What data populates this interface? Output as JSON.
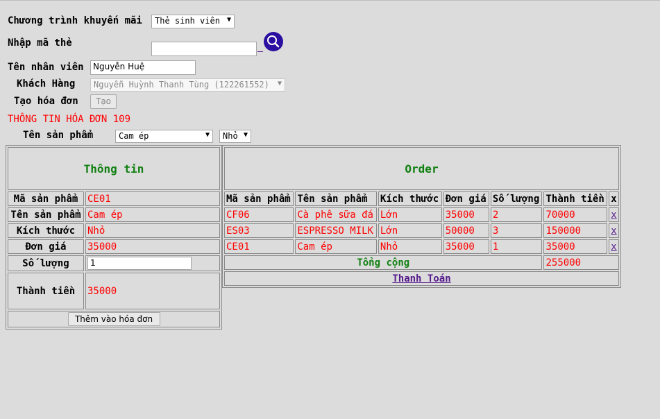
{
  "promo": {
    "label": "Chương trình khuyến mãi",
    "value": "Thẻ sinh viên"
  },
  "card": {
    "label": "Nhập mã thẻ",
    "value": ""
  },
  "employee": {
    "label": "Tên nhân viên",
    "value": "Nguyễn Huệ"
  },
  "customer": {
    "label": "Khách Hàng",
    "value": "Nguyễn Huỳnh Thanh Tùng (122261552)"
  },
  "create_invoice": {
    "label": "Tạo hóa đơn",
    "button": "Tạo"
  },
  "invoice_title": "THÔNG TIN HÓA ĐƠN 109",
  "product": {
    "label": "Tên sản phẩm",
    "value": "Cam ép",
    "size": "Nhỏ"
  },
  "info": {
    "title": "Thông tin",
    "rows": {
      "code": {
        "k": "Mã sản phẩm",
        "v": "CE01"
      },
      "name": {
        "k": "Tên sản phẩm",
        "v": "Cam ép"
      },
      "size": {
        "k": "Kích thước",
        "v": "Nhỏ"
      },
      "price": {
        "k": "Đơn giá",
        "v": "35000"
      },
      "qty": {
        "k": "Số lượng",
        "v": "1"
      },
      "total": {
        "k": "Thành tiền",
        "v": "35000"
      }
    },
    "add_button": "Thêm vào hóa đơn"
  },
  "order": {
    "title": "Order",
    "columns": [
      "Mã sản phẩm",
      "Tên sản phẩm",
      "Kích thước",
      "Đơn giá",
      "Số lượng",
      "Thành tiền",
      "x"
    ],
    "rows": [
      [
        "CF06",
        "Cà phê sữa đá",
        "Lớn",
        "35000",
        "2",
        "70000",
        "x"
      ],
      [
        "ES03",
        "ESPRESSO MILK",
        "Lớn",
        "50000",
        "3",
        "150000",
        "x"
      ],
      [
        "CE01",
        "Cam ép",
        "Nhỏ",
        "35000",
        "1",
        "35000",
        "x"
      ]
    ],
    "total_label": "Tổng cộng",
    "total_value": "255000",
    "pay_label": "Thanh Toán"
  }
}
